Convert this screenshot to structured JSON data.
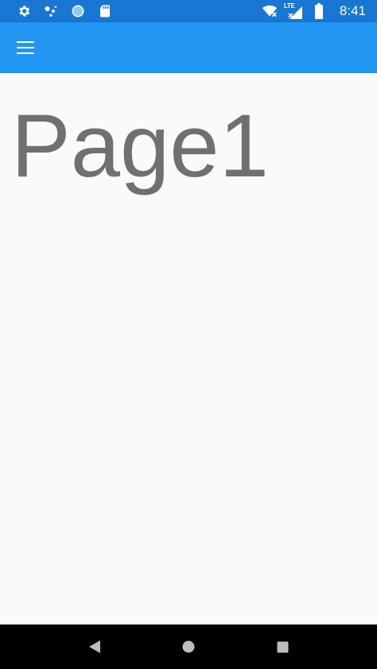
{
  "status_bar": {
    "time": "8:41",
    "network_label": "LTE",
    "background_color": "#1976d2",
    "left_icons": [
      "settings-icon",
      "assistant-icon",
      "sync-icon",
      "sd-card-icon"
    ],
    "right_icons": [
      "wifi-off-icon",
      "lte-signal-icon",
      "battery-icon"
    ]
  },
  "app_bar": {
    "background_color": "#2196f3",
    "menu_icon": "hamburger-menu-icon"
  },
  "main": {
    "title": "Page1",
    "title_color": "#707070",
    "background_color": "#fafafa"
  },
  "nav_bar": {
    "background_color": "#000000",
    "buttons": [
      "back-icon",
      "home-icon",
      "recents-icon"
    ]
  }
}
